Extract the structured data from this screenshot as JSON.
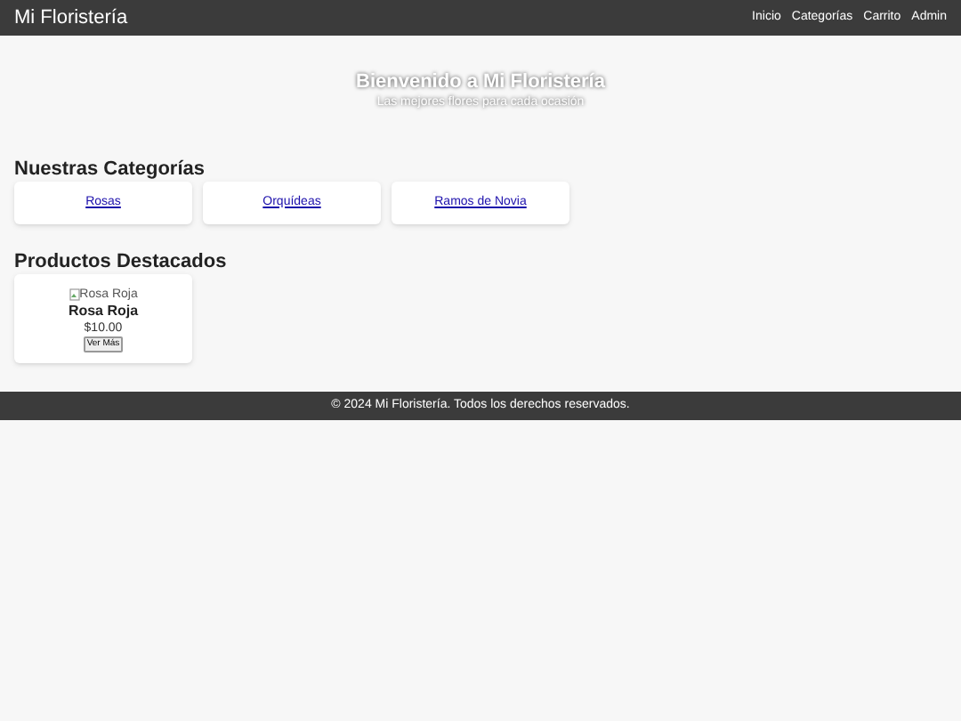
{
  "header": {
    "title": "Mi Floristería",
    "nav": [
      "Inicio",
      "Categorías",
      "Carrito",
      "Admin"
    ]
  },
  "hero": {
    "title": "Bienvenido a Mi Floristería",
    "subtitle": "Las mejores flores para cada ocasión"
  },
  "categories": {
    "heading": "Nuestras Categorías",
    "items": [
      "Rosas",
      "Orquídeas",
      "Ramos de Novia"
    ]
  },
  "products": {
    "heading": "Productos Destacados",
    "items": [
      {
        "image_alt": "Rosa Roja",
        "name": "Rosa Roja",
        "price": "$10.00",
        "button": "Ver Más"
      }
    ]
  },
  "footer": "© 2024 Mi Floristería. Todos los derechos reservados."
}
